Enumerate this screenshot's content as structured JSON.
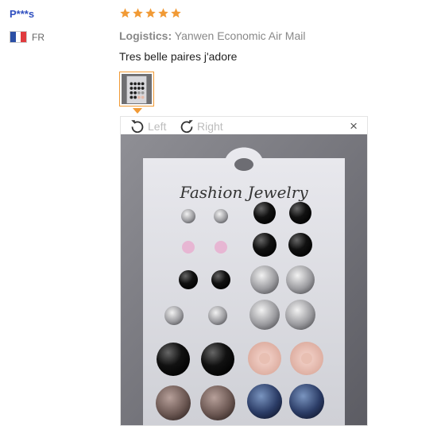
{
  "review": {
    "user_name": "P***s",
    "country_code": "FR",
    "rating": 5,
    "logistics_label": "Logistics:",
    "logistics_value": "Yanwen Economic Air Mail",
    "text": "Tres belle paires j'adore"
  },
  "viewer": {
    "rotate_left_label": "Left",
    "rotate_right_label": "Right",
    "close_label": "×",
    "card_brand": "Fashion Jewelry"
  },
  "colors": {
    "username": "#2f4fbf",
    "star": "#f19a35",
    "thumb_border": "#f19a35",
    "flag_blue": "#2b4fa5",
    "flag_red": "#e03a3e"
  }
}
